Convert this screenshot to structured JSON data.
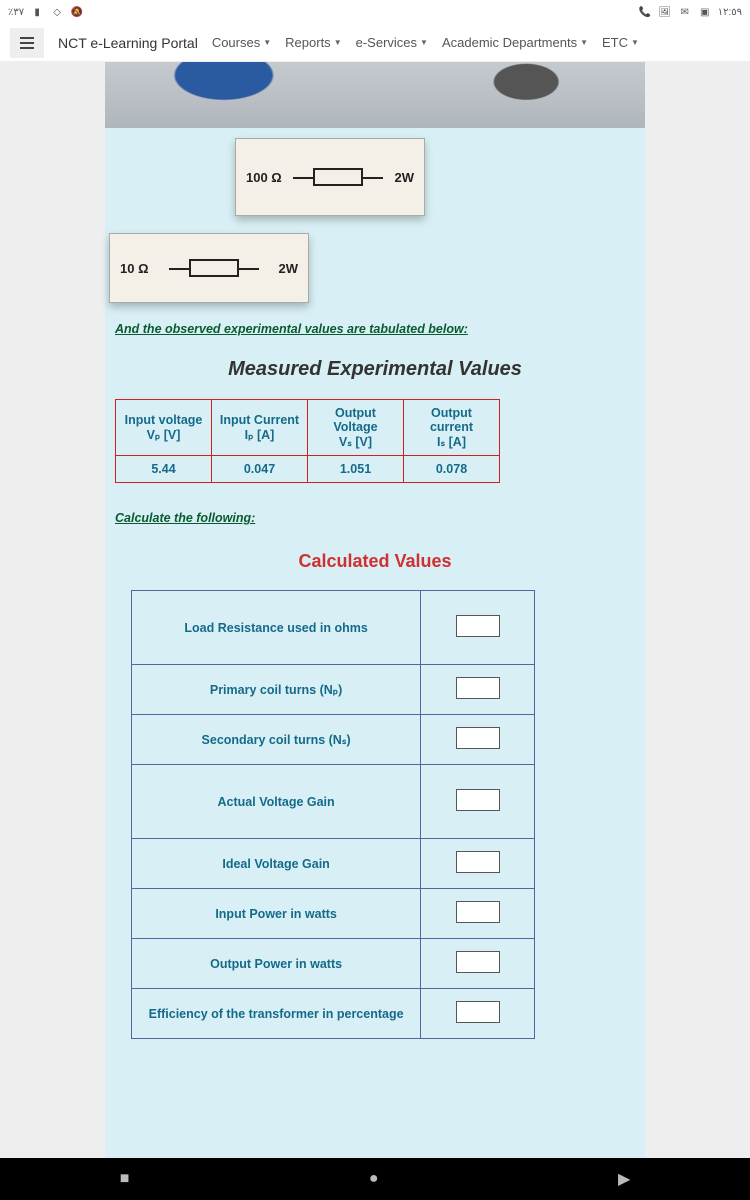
{
  "statusbar": {
    "left_text": "٪٣٧",
    "clock": "١٢:٥٩"
  },
  "header": {
    "brand": "NCT e-Learning Portal",
    "items": [
      "Courses",
      "Reports",
      "e-Services",
      "Academic Departments",
      "ETC"
    ]
  },
  "resistors": {
    "r1_value": "100 Ω",
    "r1_power": "2W",
    "r2_value": "10 Ω",
    "r2_power": "2W"
  },
  "notes": {
    "pre_table": "And the observed experimental values are tabulated below:",
    "after_table": "Calculate the following:"
  },
  "measured": {
    "title": "Measured Experimental Values",
    "headers": {
      "c1a": "Input voltage",
      "c1b": "Vₚ  [V]",
      "c2a": "Input Current",
      "c2b": "Iₚ [A]",
      "c3a": "Output Voltage",
      "c3b": "Vₛ  [V]",
      "c4a": "Output current",
      "c4b": "Iₛ  [A]"
    },
    "row": {
      "c1": "5.44",
      "c2": "0.047",
      "c3": "1.051",
      "c4": "0.078"
    }
  },
  "calculated": {
    "title": "Calculated Values",
    "rows": [
      "Load Resistance used in ohms",
      "Primary coil turns (Nₚ)",
      "Secondary coil turns (Nₛ)",
      "Actual Voltage Gain",
      "Ideal Voltage Gain",
      "Input Power in watts",
      "Output Power in watts",
      "Efficiency of the transformer in percentage"
    ]
  }
}
